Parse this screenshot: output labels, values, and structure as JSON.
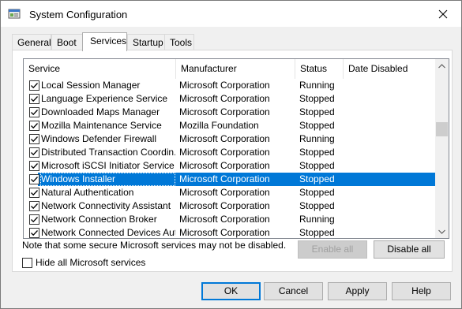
{
  "window": {
    "title": "System Configuration"
  },
  "tabs": [
    {
      "label": "General"
    },
    {
      "label": "Boot"
    },
    {
      "label": "Services"
    },
    {
      "label": "Startup"
    },
    {
      "label": "Tools"
    }
  ],
  "active_tab": "Services",
  "table": {
    "headers": [
      "Service",
      "Manufacturer",
      "Status",
      "Date Disabled"
    ],
    "rows": [
      {
        "service": "Local Session Manager",
        "manufacturer": "Microsoft Corporation",
        "status": "Running",
        "checked": true
      },
      {
        "service": "Language Experience Service",
        "manufacturer": "Microsoft Corporation",
        "status": "Stopped",
        "checked": true
      },
      {
        "service": "Downloaded Maps Manager",
        "manufacturer": "Microsoft Corporation",
        "status": "Stopped",
        "checked": true
      },
      {
        "service": "Mozilla Maintenance Service",
        "manufacturer": "Mozilla Foundation",
        "status": "Stopped",
        "checked": true
      },
      {
        "service": "Windows Defender Firewall",
        "manufacturer": "Microsoft Corporation",
        "status": "Running",
        "checked": true
      },
      {
        "service": "Distributed Transaction Coordin...",
        "manufacturer": "Microsoft Corporation",
        "status": "Stopped",
        "checked": true
      },
      {
        "service": "Microsoft iSCSI Initiator Service",
        "manufacturer": "Microsoft Corporation",
        "status": "Stopped",
        "checked": true
      },
      {
        "service": "Windows Installer",
        "manufacturer": "Microsoft Corporation",
        "status": "Stopped",
        "checked": true,
        "selected": true
      },
      {
        "service": "Natural Authentication",
        "manufacturer": "Microsoft Corporation",
        "status": "Stopped",
        "checked": true
      },
      {
        "service": "Network Connectivity Assistant",
        "manufacturer": "Microsoft Corporation",
        "status": "Stopped",
        "checked": true
      },
      {
        "service": "Network Connection Broker",
        "manufacturer": "Microsoft Corporation",
        "status": "Running",
        "checked": true
      },
      {
        "service": "Network Connected Devices Aut...",
        "manufacturer": "Microsoft Corporation",
        "status": "Stopped",
        "checked": true
      }
    ]
  },
  "note": "Note that some secure Microsoft services may not be disabled.",
  "buttons": {
    "enable_all": "Enable all",
    "disable_all": "Disable all",
    "ok": "OK",
    "cancel": "Cancel",
    "apply": "Apply",
    "help": "Help"
  },
  "hide_ms": {
    "label": "Hide all Microsoft services",
    "checked": false
  },
  "colors": {
    "selection": "#0078d7",
    "dialog_bg": "#f0f0f0"
  },
  "icons": [
    "app-config-icon",
    "close-icon",
    "scroll-up-icon",
    "scroll-down-icon",
    "checkmark-icon"
  ]
}
